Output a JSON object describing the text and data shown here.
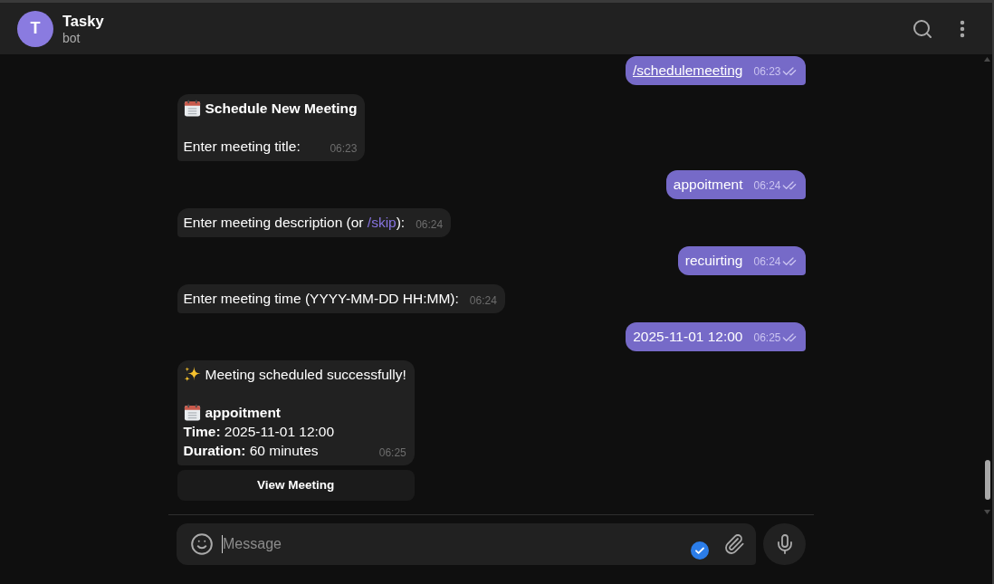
{
  "header": {
    "avatar_letter": "T",
    "title": "Tasky",
    "subtitle": "bot"
  },
  "messages": [
    {
      "kind": "outgoing",
      "lines": [
        {
          "kind": "text",
          "parts": [
            {
              "kind": "link",
              "text": "/schedulemeeting"
            }
          ]
        }
      ],
      "time": "06:23",
      "read": true
    },
    {
      "kind": "incoming",
      "lines": [
        {
          "kind": "event",
          "bold": true,
          "parts": [
            {
              "kind": "text",
              "text": "Schedule New Meeting"
            }
          ]
        },
        {
          "kind": "text",
          "gap_before": true,
          "parts": [
            {
              "kind": "text",
              "text": "Enter meeting title:"
            }
          ]
        }
      ],
      "time": "06:23"
    },
    {
      "kind": "outgoing",
      "lines": [
        {
          "kind": "text",
          "parts": [
            {
              "kind": "text",
              "text": "appoitment"
            }
          ]
        }
      ],
      "time": "06:24",
      "read": true
    },
    {
      "kind": "incoming",
      "lines": [
        {
          "kind": "text",
          "parts": [
            {
              "kind": "text",
              "text": "Enter meeting description (or "
            },
            {
              "kind": "link",
              "text": "/skip"
            },
            {
              "kind": "text",
              "text": "):"
            }
          ]
        }
      ],
      "time": "06:24"
    },
    {
      "kind": "outgoing",
      "lines": [
        {
          "kind": "text",
          "parts": [
            {
              "kind": "text",
              "text": "recuirting"
            }
          ]
        }
      ],
      "time": "06:24",
      "read": true
    },
    {
      "kind": "incoming",
      "lines": [
        {
          "kind": "text",
          "parts": [
            {
              "kind": "text",
              "text": "Enter meeting time (YYYY-MM-DD HH:MM):"
            }
          ]
        }
      ],
      "time": "06:24"
    },
    {
      "kind": "outgoing",
      "lines": [
        {
          "kind": "text",
          "parts": [
            {
              "kind": "text",
              "text": "2025-11-01 12:00"
            }
          ]
        }
      ],
      "time": "06:25",
      "read": true
    },
    {
      "kind": "incoming",
      "lines": [
        {
          "kind": "success",
          "parts": [
            {
              "kind": "text",
              "text": "Meeting scheduled successfully!"
            }
          ]
        },
        {
          "kind": "event",
          "bold": true,
          "gap_before": true,
          "parts": [
            {
              "kind": "text",
              "text": "appoitment"
            }
          ]
        },
        {
          "kind": "text",
          "parts": [
            {
              "kind": "text",
              "text": "**Time:** 2025-11-01 12:00"
            }
          ]
        },
        {
          "kind": "text",
          "parts": [
            {
              "kind": "text",
              "text": "**Duration:** 60 minutes"
            }
          ]
        }
      ],
      "time": "06:25",
      "buttons": [
        {
          "label": "View Meeting"
        }
      ]
    }
  ],
  "composer": {
    "placeholder": "Message",
    "focused": true
  }
}
